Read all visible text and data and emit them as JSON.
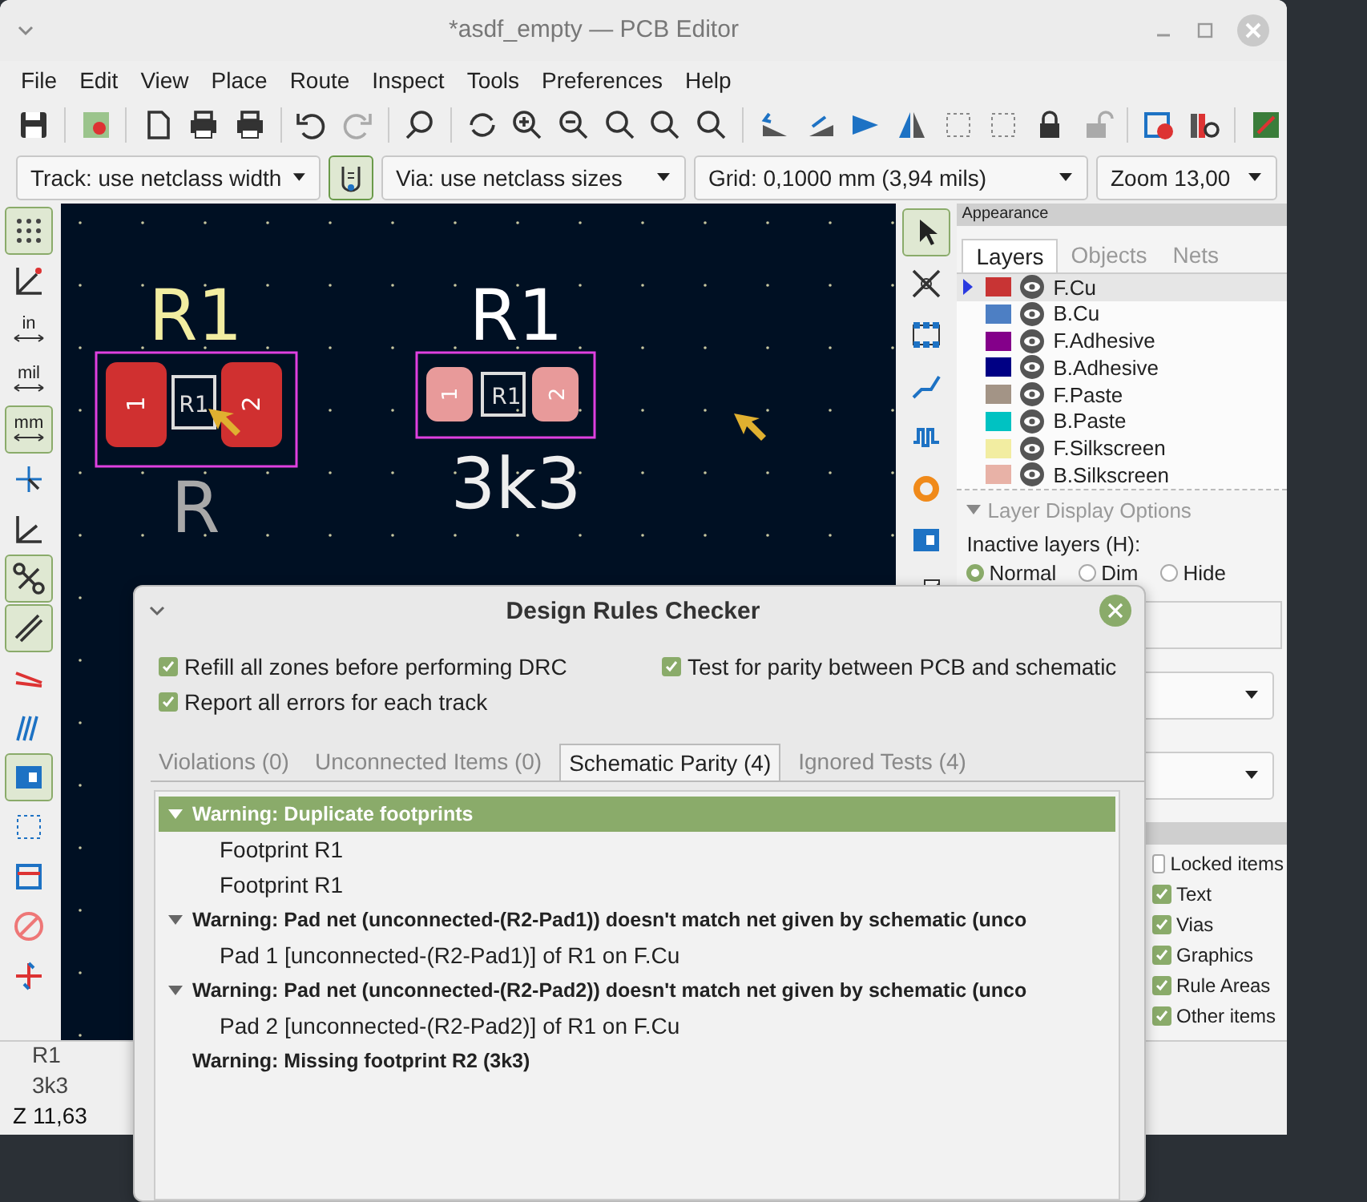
{
  "window": {
    "title": "*asdf_empty — PCB Editor"
  },
  "menu": [
    "File",
    "Edit",
    "View",
    "Place",
    "Route",
    "Inspect",
    "Tools",
    "Preferences",
    "Help"
  ],
  "track_select": {
    "value": "Track: use netclass width"
  },
  "netclass_toggle": {
    "on": true
  },
  "via_select": {
    "value": "Via: use netclass sizes"
  },
  "grid_select": {
    "value": "Grid: 0,1000 mm (3,94 mils)"
  },
  "zoom_select": {
    "value": "Zoom 13,00"
  },
  "left_toolbar": [
    {
      "kind": "icon",
      "selected": true
    },
    {
      "kind": "icon",
      "selected": false
    },
    {
      "kind": "text",
      "label": "in",
      "selected": false
    },
    {
      "kind": "text",
      "label": "mil",
      "selected": false
    },
    {
      "kind": "text",
      "label": "mm",
      "selected": true
    },
    {
      "kind": "icon",
      "selected": false
    },
    {
      "kind": "icon",
      "selected": false
    },
    {
      "kind": "icon",
      "selected": true
    },
    {
      "kind": "icon",
      "selected": true
    },
    {
      "kind": "icon",
      "selected": false
    },
    {
      "kind": "icon",
      "selected": false
    },
    {
      "kind": "icon",
      "selected": true
    },
    {
      "kind": "icon",
      "selected": false
    },
    {
      "kind": "icon",
      "selected": false
    },
    {
      "kind": "icon",
      "selected": false
    },
    {
      "kind": "icon",
      "selected": false
    }
  ],
  "right_toolbar": [
    {
      "selected": true
    },
    {
      "selected": false
    },
    {
      "selected": false
    },
    {
      "selected": false
    },
    {
      "selected": false
    },
    {
      "selected": false
    },
    {
      "selected": false
    },
    {
      "selected": false
    }
  ],
  "canvas": {
    "footprints": [
      {
        "reference": "R1",
        "value": "R",
        "fab_reference": "R1",
        "pads": [
          "1",
          "2"
        ],
        "highlighted": false
      },
      {
        "reference": "R1",
        "value": "3k3",
        "fab_reference": "R1",
        "pads": [
          "1",
          "2"
        ],
        "highlighted": true
      }
    ]
  },
  "appearance": {
    "title": "Appearance",
    "tabs": [
      {
        "label": "Layers",
        "selected": true
      },
      {
        "label": "Objects",
        "selected": false
      },
      {
        "label": "Nets",
        "selected": false
      }
    ],
    "layers": [
      {
        "name": "F.Cu",
        "color": "#c83434",
        "selected": true
      },
      {
        "name": "B.Cu",
        "color": "#4d7fc4",
        "selected": false
      },
      {
        "name": "F.Adhesive",
        "color": "#84008a",
        "selected": false
      },
      {
        "name": "B.Adhesive",
        "color": "#000084",
        "selected": false
      },
      {
        "name": "F.Paste",
        "color": "#a39486",
        "selected": false
      },
      {
        "name": "B.Paste",
        "color": "#00c2c2",
        "selected": false
      },
      {
        "name": "F.Silkscreen",
        "color": "#f2eda1",
        "selected": false
      },
      {
        "name": "B.Silkscreen",
        "color": "#e8b2a7",
        "selected": false
      }
    ],
    "display_options": "Layer Display Options",
    "inactive_label": "Inactive layers (H):",
    "inactive_modes": [
      {
        "label": "Normal",
        "selected": true
      },
      {
        "label": "Dim",
        "selected": false
      },
      {
        "label": "Hide",
        "selected": false
      }
    ],
    "selection_filter": [
      {
        "label": "Locked items",
        "checked": false
      },
      {
        "label": "Text",
        "checked": true
      },
      {
        "label": "Vias",
        "checked": true
      },
      {
        "label": "Graphics",
        "checked": true
      },
      {
        "label": "Rule Areas",
        "checked": true
      },
      {
        "label": "Other items",
        "checked": true
      }
    ]
  },
  "status_bar": {
    "lines": [
      "R1",
      "3k3"
    ],
    "zoom": "Z 11,63"
  },
  "drc": {
    "title": "Design Rules Checker",
    "options": [
      {
        "label": "Refill all zones before performing DRC",
        "checked": true
      },
      {
        "label": "Test for parity between PCB and schematic",
        "checked": true
      },
      {
        "label": "Report all errors for each track",
        "checked": true
      }
    ],
    "tabs": [
      {
        "label": "Violations (0)",
        "selected": false
      },
      {
        "label": "Unconnected Items (0)",
        "selected": false
      },
      {
        "label": "Schematic Parity (4)",
        "selected": true
      },
      {
        "label": "Ignored Tests (4)",
        "selected": false
      }
    ],
    "items": [
      {
        "text": "Warning: Duplicate footprints",
        "expanded": true,
        "selected": true,
        "children": [
          {
            "text": "Footprint R1"
          },
          {
            "text": "Footprint R1"
          }
        ]
      },
      {
        "text": "Warning: Pad net (unconnected-(R2-Pad1)) doesn't match net given by schematic (unco",
        "expanded": true,
        "selected": false,
        "children": [
          {
            "text": "Pad 1 [unconnected-(R2-Pad1)] of R1 on F.Cu"
          }
        ]
      },
      {
        "text": "Warning: Pad net (unconnected-(R2-Pad2)) doesn't match net given by schematic (unco",
        "expanded": true,
        "selected": false,
        "children": [
          {
            "text": "Pad 2 [unconnected-(R2-Pad2)] of R1 on F.Cu"
          }
        ]
      },
      {
        "text": "Warning: Missing footprint R2 (3k3)",
        "expanded": false,
        "selected": false
      }
    ]
  }
}
